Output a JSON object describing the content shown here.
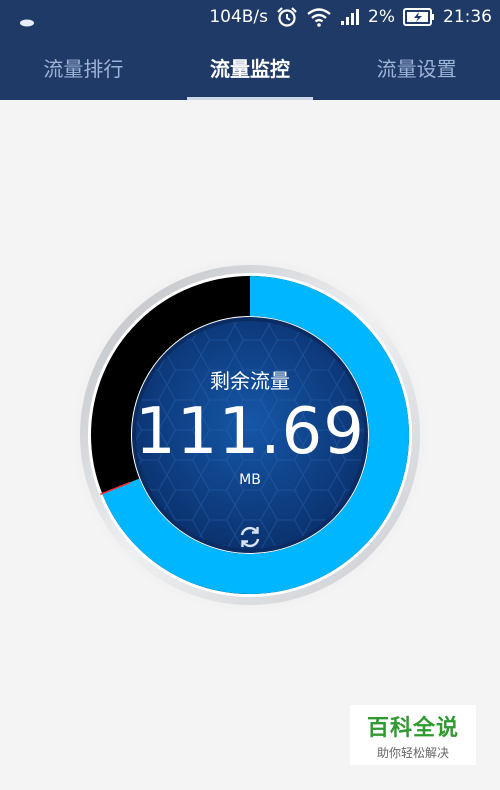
{
  "statusbar": {
    "speed": "104B/s",
    "battery_percent": "2%",
    "time": "21:36"
  },
  "tabs": [
    {
      "label": "流量排行",
      "active": false
    },
    {
      "label": "流量监控",
      "active": true
    },
    {
      "label": "流量设置",
      "active": false
    }
  ],
  "gauge": {
    "label": "剩余流量",
    "value": "111.69",
    "unit": "MB",
    "remaining_fraction": 0.69,
    "used_fraction": 0.31
  },
  "watermark": {
    "title": "百科全说",
    "subtitle": "助你轻松解决"
  },
  "colors": {
    "bar": "#1f3a66",
    "accent": "#00b6ff",
    "dial_center": "#0d3f86"
  }
}
